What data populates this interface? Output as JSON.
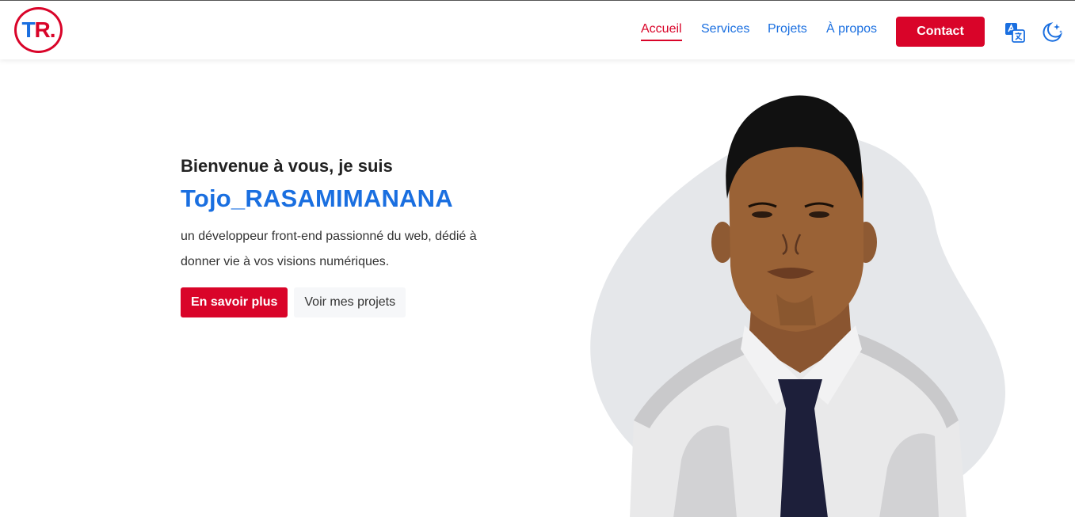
{
  "navbar": {
    "logo": {
      "t": "T",
      "r": "R."
    },
    "links": [
      {
        "label": "Accueil",
        "active": true
      },
      {
        "label": "Services",
        "active": false
      },
      {
        "label": "Projets",
        "active": false
      },
      {
        "label": "À propos",
        "active": false
      }
    ],
    "contact_label": "Contact",
    "icons": [
      "translate-icon",
      "dark-mode-moon-icon"
    ]
  },
  "hero": {
    "greeting": "Bienvenue à vous, je suis",
    "name": "Tojo_RASAMIMANANA",
    "description": "un développeur front-end passionné du web, dédié à donner vie à vos visions numériques.",
    "primary_button": "En savoir plus",
    "secondary_button": "Voir mes projets"
  },
  "colors": {
    "primary_red": "#d90429",
    "accent_blue": "#1a6fe0",
    "blob_gray": "#e5e7ea"
  }
}
